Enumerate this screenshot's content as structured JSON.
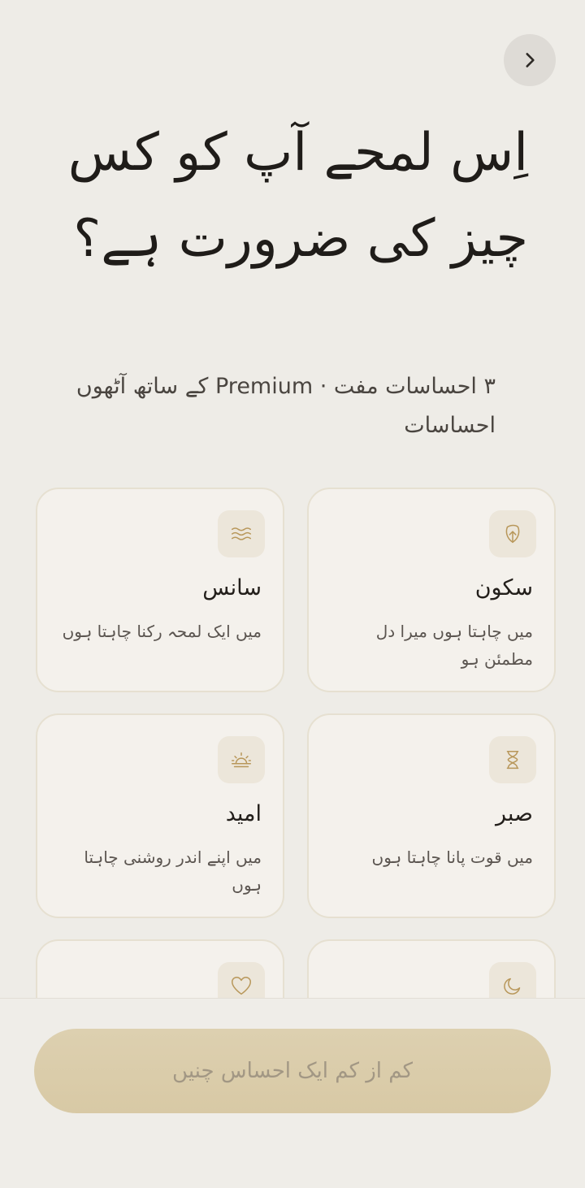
{
  "header": {
    "title": "اِس لمحے آپ کو کس چیز کی ضرورت ہے؟",
    "subtitle": "۳ احساسات مفت · Premium کے ساتھ آٹھوں احساسات"
  },
  "cards": [
    {
      "title": "سکون",
      "description": "میں چاہتا ہوں میرا دل مطمئن ہو",
      "icon": "leaf-icon"
    },
    {
      "title": "سانس",
      "description": "میں ایک لمحہ رکنا چاہتا ہوں",
      "icon": "waves-icon"
    },
    {
      "title": "صبر",
      "description": "میں قوت پانا چاہتا ہوں",
      "icon": "hourglass-icon"
    },
    {
      "title": "امید",
      "description": "میں اپنے اندر روشنی چاہتا ہوں",
      "icon": "sunrise-icon"
    },
    {
      "title": "",
      "description": "",
      "icon": "moon-icon"
    },
    {
      "title": "",
      "description": "",
      "icon": "heart-icon"
    }
  ],
  "cta": {
    "label": "کم از کم ایک احساس چنیں"
  },
  "colors": {
    "background": "#eeece7",
    "card": "#f4f1ec",
    "accent": "#b8975a",
    "cta": "#d8c9a5"
  }
}
